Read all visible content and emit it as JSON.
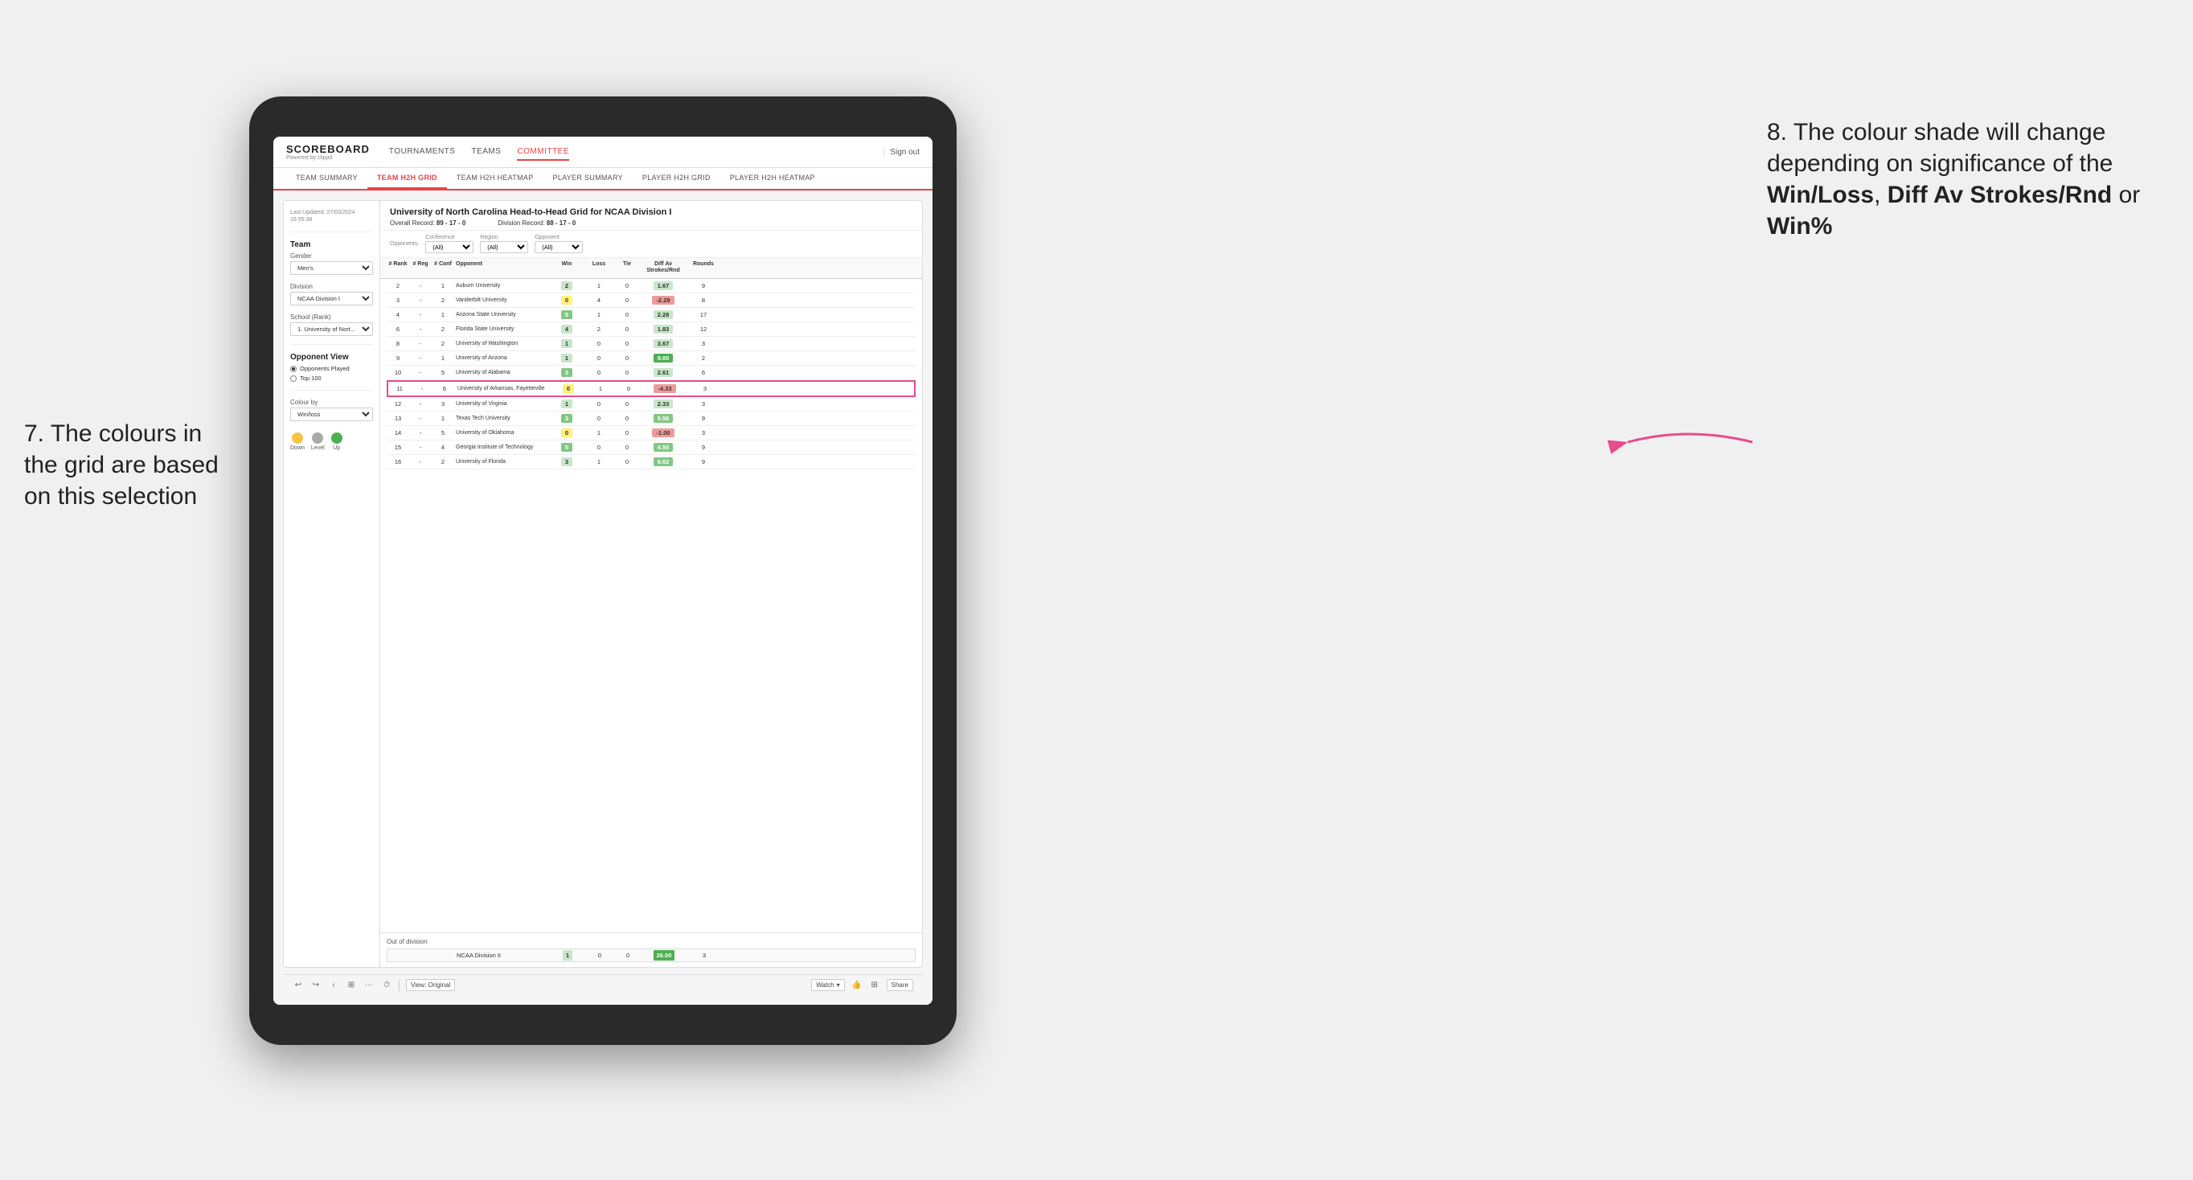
{
  "annotations": {
    "left_title": "7. The colours in the grid are based on this selection",
    "right_title": "8. The colour shade will change depending on significance of the",
    "right_bold1": "Win/Loss",
    "right_comma": ", ",
    "right_bold2": "Diff Av Strokes/Rnd",
    "right_or": " or ",
    "right_bold3": "Win%"
  },
  "header": {
    "logo": "SCOREBOARD",
    "logo_sub": "Powered by clippd",
    "nav": [
      "TOURNAMENTS",
      "TEAMS",
      "COMMITTEE"
    ],
    "sign_out": "Sign out"
  },
  "subnav": {
    "items": [
      "TEAM SUMMARY",
      "TEAM H2H GRID",
      "TEAM H2H HEATMAP",
      "PLAYER SUMMARY",
      "PLAYER H2H GRID",
      "PLAYER H2H HEATMAP"
    ],
    "active": "TEAM H2H GRID"
  },
  "sidebar": {
    "last_updated_label": "Last Updated: 27/03/2024",
    "last_updated_time": "16:55:38",
    "team_label": "Team",
    "gender_label": "Gender",
    "gender_value": "Men's",
    "division_label": "Division",
    "division_value": "NCAA Division I",
    "school_rank_label": "School (Rank)",
    "school_rank_value": "1. University of Nort...",
    "opponent_view_label": "Opponent View",
    "radio1": "Opponents Played",
    "radio2": "Top 100",
    "colour_by_label": "Colour by",
    "colour_by_value": "Win/loss",
    "legend_down": "Down",
    "legend_level": "Level",
    "legend_up": "Up"
  },
  "data_area": {
    "main_title": "University of North Carolina Head-to-Head Grid for NCAA Division I",
    "overall_record_label": "Overall Record:",
    "overall_record_value": "89 - 17 - 0",
    "division_record_label": "Division Record:",
    "division_record_value": "88 - 17 - 0",
    "filters": {
      "opponents_label": "Opponents:",
      "opponents_value": "(All)",
      "conference_label": "Conference",
      "conference_value": "(All)",
      "region_label": "Region",
      "region_value": "(All)",
      "opponent_label": "Opponent",
      "opponent_value": "(All)"
    },
    "col_headers": [
      "# Rank",
      "# Reg",
      "# Conf",
      "Opponent",
      "Win",
      "Loss",
      "Tie",
      "Diff Av Strokes/Rnd",
      "Rounds"
    ],
    "rows": [
      {
        "rank": "2",
        "reg": "-",
        "conf": "1",
        "opponent": "Auburn University",
        "win": "2",
        "loss": "1",
        "tie": "0",
        "diff": "1.67",
        "rounds": "9",
        "win_color": "green_light",
        "diff_color": "green_light"
      },
      {
        "rank": "3",
        "reg": "-",
        "conf": "2",
        "opponent": "Vanderbilt University",
        "win": "0",
        "loss": "4",
        "tie": "0",
        "diff": "-2.29",
        "rounds": "8",
        "win_color": "yellow",
        "diff_color": "red_light"
      },
      {
        "rank": "4",
        "reg": "-",
        "conf": "1",
        "opponent": "Arizona State University",
        "win": "5",
        "loss": "1",
        "tie": "0",
        "diff": "2.28",
        "rounds": "17",
        "win_color": "green_mid",
        "diff_color": "green_light"
      },
      {
        "rank": "6",
        "reg": "-",
        "conf": "2",
        "opponent": "Florida State University",
        "win": "4",
        "loss": "2",
        "tie": "0",
        "diff": "1.83",
        "rounds": "12",
        "win_color": "green_light",
        "diff_color": "green_light"
      },
      {
        "rank": "8",
        "reg": "-",
        "conf": "2",
        "opponent": "University of Washington",
        "win": "1",
        "loss": "0",
        "tie": "0",
        "diff": "3.67",
        "rounds": "3",
        "win_color": "green_light",
        "diff_color": "green_light"
      },
      {
        "rank": "9",
        "reg": "-",
        "conf": "1",
        "opponent": "University of Arizona",
        "win": "1",
        "loss": "0",
        "tie": "0",
        "diff": "9.00",
        "rounds": "2",
        "win_color": "green_light",
        "diff_color": "green_dark"
      },
      {
        "rank": "10",
        "reg": "-",
        "conf": "5",
        "opponent": "University of Alabama",
        "win": "3",
        "loss": "0",
        "tie": "0",
        "diff": "2.61",
        "rounds": "6",
        "win_color": "green_mid",
        "diff_color": "green_light"
      },
      {
        "rank": "11",
        "reg": "-",
        "conf": "6",
        "opponent": "University of Arkansas, Fayetteville",
        "win": "0",
        "loss": "1",
        "tie": "0",
        "diff": "-4.33",
        "rounds": "3",
        "win_color": "yellow",
        "diff_color": "red_light"
      },
      {
        "rank": "12",
        "reg": "-",
        "conf": "3",
        "opponent": "University of Virginia",
        "win": "1",
        "loss": "0",
        "tie": "0",
        "diff": "2.33",
        "rounds": "3",
        "win_color": "green_light",
        "diff_color": "green_light"
      },
      {
        "rank": "13",
        "reg": "-",
        "conf": "1",
        "opponent": "Texas Tech University",
        "win": "3",
        "loss": "0",
        "tie": "0",
        "diff": "5.56",
        "rounds": "9",
        "win_color": "green_mid",
        "diff_color": "green_mid"
      },
      {
        "rank": "14",
        "reg": "-",
        "conf": "5",
        "opponent": "University of Oklahoma",
        "win": "0",
        "loss": "1",
        "tie": "0",
        "diff": "-1.00",
        "rounds": "3",
        "win_color": "yellow",
        "diff_color": "red_light"
      },
      {
        "rank": "15",
        "reg": "-",
        "conf": "4",
        "opponent": "Georgia Institute of Technology",
        "win": "5",
        "loss": "0",
        "tie": "0",
        "diff": "4.50",
        "rounds": "9",
        "win_color": "green_mid",
        "diff_color": "green_mid"
      },
      {
        "rank": "16",
        "reg": "-",
        "conf": "2",
        "opponent": "University of Florida",
        "win": "3",
        "loss": "1",
        "tie": "0",
        "diff": "6.62",
        "rounds": "9",
        "win_color": "green_light",
        "diff_color": "green_mid"
      }
    ],
    "out_of_division_label": "Out of division",
    "out_of_division_row": {
      "name": "NCAA Division II",
      "win": "1",
      "loss": "0",
      "tie": "0",
      "diff": "26.00",
      "rounds": "3"
    }
  },
  "toolbar": {
    "view_label": "View: Original",
    "watch_label": "Watch",
    "share_label": "Share"
  }
}
